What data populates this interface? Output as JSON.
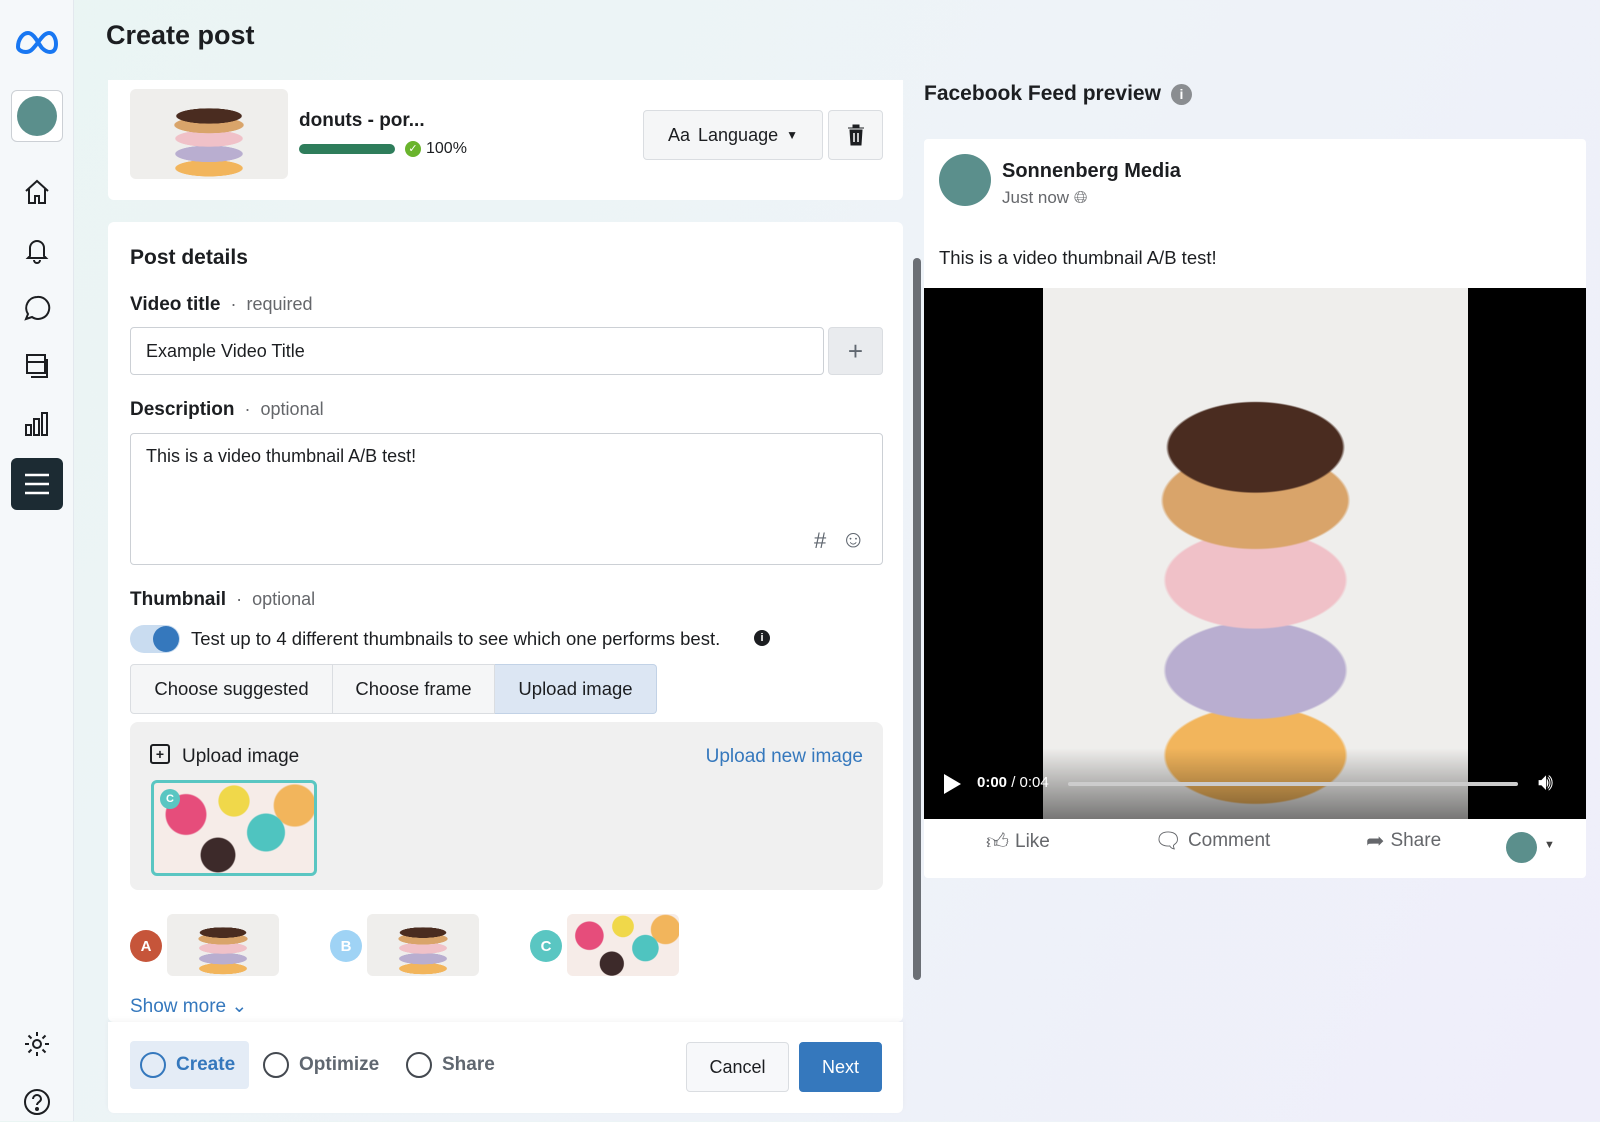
{
  "header": {
    "title": "Create post"
  },
  "sidebar": {
    "items": [
      "home",
      "notifications",
      "messages",
      "content",
      "insights",
      "all-tools"
    ],
    "bottom": [
      "settings",
      "help"
    ]
  },
  "upload": {
    "filename": "donuts - por...",
    "progress_percent": 100,
    "progress_label": "100%",
    "language_button": "Language",
    "language_prefix": "Aa"
  },
  "post_details": {
    "heading": "Post details",
    "video_title_label": "Video title",
    "video_title_req": "required",
    "video_title_value": "Example Video Title",
    "description_label": "Description",
    "description_req": "optional",
    "description_value": "This is a video thumbnail A/B test!",
    "thumbnail_label": "Thumbnail",
    "thumbnail_req": "optional",
    "toggle_on": true,
    "toggle_text": "Test up to 4 different thumbnails to see which one performs best.",
    "tabs": [
      "Choose suggested",
      "Choose frame",
      "Upload image"
    ],
    "active_tab": "Upload image",
    "upload_image_label": "Upload image",
    "upload_new_link": "Upload new image",
    "selected_badge": "C",
    "variants": [
      {
        "letter": "A",
        "color": "#c6553a"
      },
      {
        "letter": "B",
        "color": "#9fd3f5"
      },
      {
        "letter": "C",
        "color": "#5ac6c2"
      }
    ],
    "show_more": "Show more"
  },
  "footer": {
    "steps": [
      "Create",
      "Optimize",
      "Share"
    ],
    "active_step": "Create",
    "cancel": "Cancel",
    "next": "Next"
  },
  "preview": {
    "title": "Facebook Feed preview",
    "page_name": "Sonnenberg Media",
    "time": "Just now",
    "text": "This is a video thumbnail A/B test!",
    "time_code": "0:00",
    "duration": "/ 0:04",
    "actions": [
      "Like",
      "Comment",
      "Share"
    ]
  },
  "colors": {
    "accent": "#3578bd",
    "progress": "#2e7d5b",
    "brand_avatar": "#5b8f8c"
  }
}
